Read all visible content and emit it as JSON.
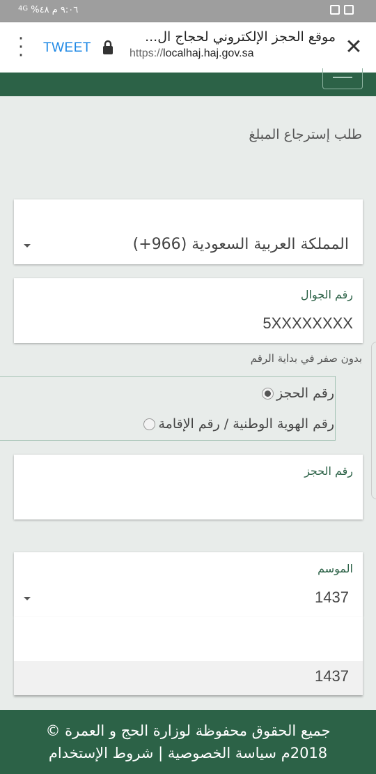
{
  "status_bar": {
    "time_battery": "٩:٠٦ م  ٤٨%",
    "network": "4G"
  },
  "browser": {
    "title": "موقع الحجز الإلكتروني لحجاج ال...",
    "url_prefix": "https://",
    "url_domain": "localhaj.haj.gov.sa",
    "tweet_label": "TWEET"
  },
  "form": {
    "title": "طلب إسترجاع المبلغ",
    "country_select": "المملكة العربية السعودية (966+)",
    "mobile_label": "رقم الجوال",
    "mobile_value": "5XXXXXXXX",
    "mobile_hint": "بدون صفر في بداية الرقم",
    "radio_options": [
      {
        "label": "رقم الحجز",
        "checked": true
      },
      {
        "label": "رقم الهوية الوطنية / رقم الإقامة",
        "checked": false
      }
    ],
    "booking_label": "رقم الحجز",
    "season_label": "الموسم",
    "season_value": "1437",
    "season_options": [
      "",
      "1437"
    ]
  },
  "footer": {
    "line1": "جميع الحقوق محفوظة لوزارة الحج و العمرة ©",
    "line2_year": "2018م",
    "privacy": "سياسة الخصوصية",
    "separator": "|",
    "terms": "شروط الإستخدام"
  }
}
